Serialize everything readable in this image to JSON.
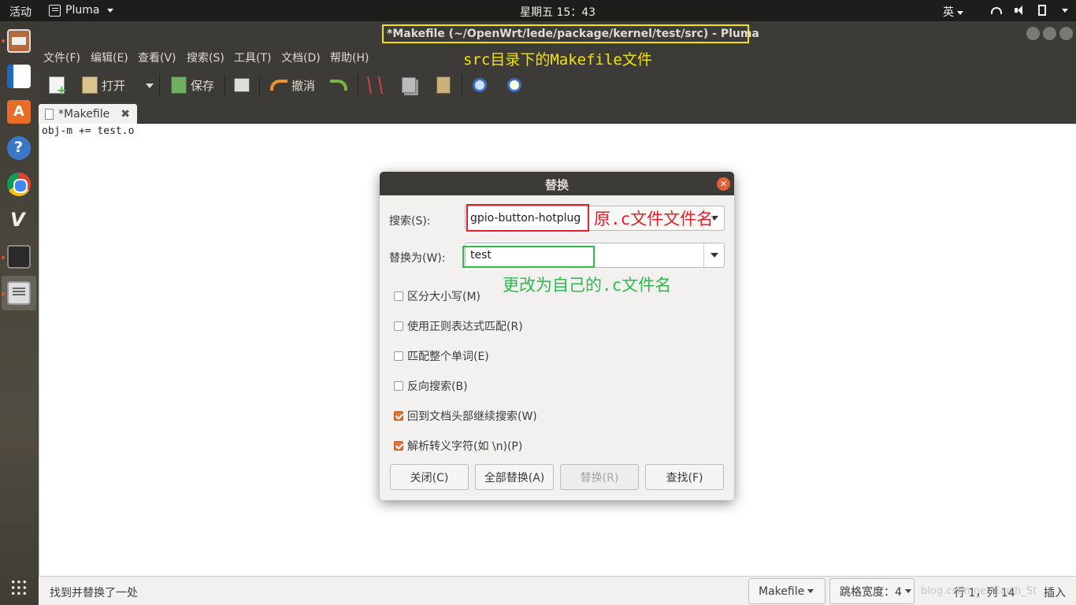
{
  "topbar": {
    "activities": "活动",
    "app_name": "Pluma",
    "clock": "星期五 15：43",
    "input_method": "英"
  },
  "window": {
    "title": "*Makefile (~/OpenWrt/lede/package/kernel/test/src) - Pluma"
  },
  "menu": [
    "文件(F)",
    "编辑(E)",
    "查看(V)",
    "搜索(S)",
    "工具(T)",
    "文档(D)",
    "帮助(H)"
  ],
  "annotations": {
    "title_note": "src目录下的Makefile文件",
    "search_note": "原.c文件文件名",
    "replace_note": "更改为自己的.c文件名"
  },
  "toolbar": {
    "open_label": "打开",
    "save_label": "保存",
    "undo_label": "撤消"
  },
  "tab": {
    "label": "*Makefile"
  },
  "editor": {
    "content": "obj-m += test.o"
  },
  "dialog": {
    "title": "替换",
    "search_label": "搜索(S):",
    "search_value": "gpio-button-hotplug",
    "replace_label": "替换为(W):",
    "replace_value": "test",
    "options": [
      {
        "label": "区分大小写(M)",
        "checked": false
      },
      {
        "label": "使用正则表达式匹配(R)",
        "checked": false
      },
      {
        "label": "匹配整个单词(E)",
        "checked": false
      },
      {
        "label": "反向搜索(B)",
        "checked": false
      },
      {
        "label": "回到文档头部继续搜索(W)",
        "checked": true
      },
      {
        "label": "解析转义字符(如 \\n)(P)",
        "checked": true
      }
    ],
    "buttons": {
      "close": "关闭(C)",
      "replace_all": "全部替换(A)",
      "replace": "替换(R)",
      "find": "查找(F)"
    }
  },
  "statusbar": {
    "message": "找到并替换了一处",
    "language": "Makefile",
    "tab_width": "跳格宽度：4",
    "position": "行 1，列 14",
    "mode": "插入",
    "watermark": "blog.csdn.net/Earth_St"
  },
  "colors": {
    "highlight_yellow": "#f2e400",
    "highlight_red": "#e0202a",
    "highlight_green": "#2dbb4e",
    "accent_orange": "#e0743c"
  }
}
